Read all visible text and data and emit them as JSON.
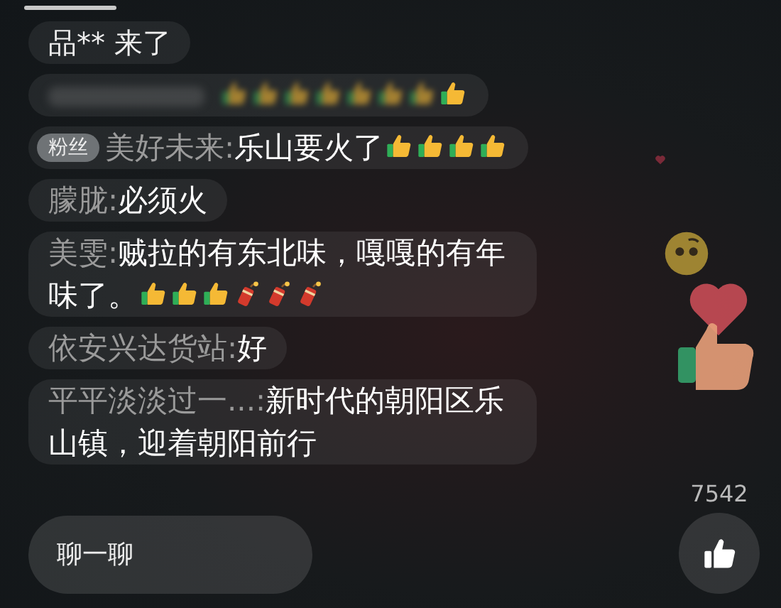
{
  "messages": [
    {
      "kind": "join",
      "text": "品** 来了"
    },
    {
      "kind": "faded",
      "emojis": [
        {
          "kind": "thumbs-up"
        },
        {
          "kind": "thumbs-up"
        },
        {
          "kind": "thumbs-up"
        },
        {
          "kind": "thumbs-up"
        },
        {
          "kind": "thumbs-up"
        },
        {
          "kind": "thumbs-up"
        },
        {
          "kind": "thumbs-up"
        },
        {
          "kind": "thumbs-up"
        }
      ]
    },
    {
      "kind": "chat",
      "badge": "粉丝",
      "user": "美好未来:",
      "text": "乐山要火了",
      "emojis": [
        {
          "kind": "thumbs-up"
        },
        {
          "kind": "thumbs-up"
        },
        {
          "kind": "thumbs-up"
        },
        {
          "kind": "thumbs-up"
        }
      ]
    },
    {
      "kind": "chat",
      "user": "朦胧:",
      "text": "必须火"
    },
    {
      "kind": "chat",
      "user": "美雯:",
      "text": "贼拉的有东北味，嘎嘎的有年味了。",
      "emojis": [
        {
          "kind": "thumbs-up"
        },
        {
          "kind": "thumbs-up"
        },
        {
          "kind": "thumbs-up"
        },
        {
          "kind": "firecracker"
        },
        {
          "kind": "firecracker"
        },
        {
          "kind": "firecracker"
        }
      ]
    },
    {
      "kind": "chat",
      "user": "依安兴达货站:",
      "text": "好"
    },
    {
      "kind": "chat",
      "user": "平平淡淡过一...:",
      "text": "新时代的朝阳区乐山镇，迎着朝阳前行"
    }
  ],
  "input": {
    "placeholder": "聊一聊"
  },
  "like_count": "7542"
}
